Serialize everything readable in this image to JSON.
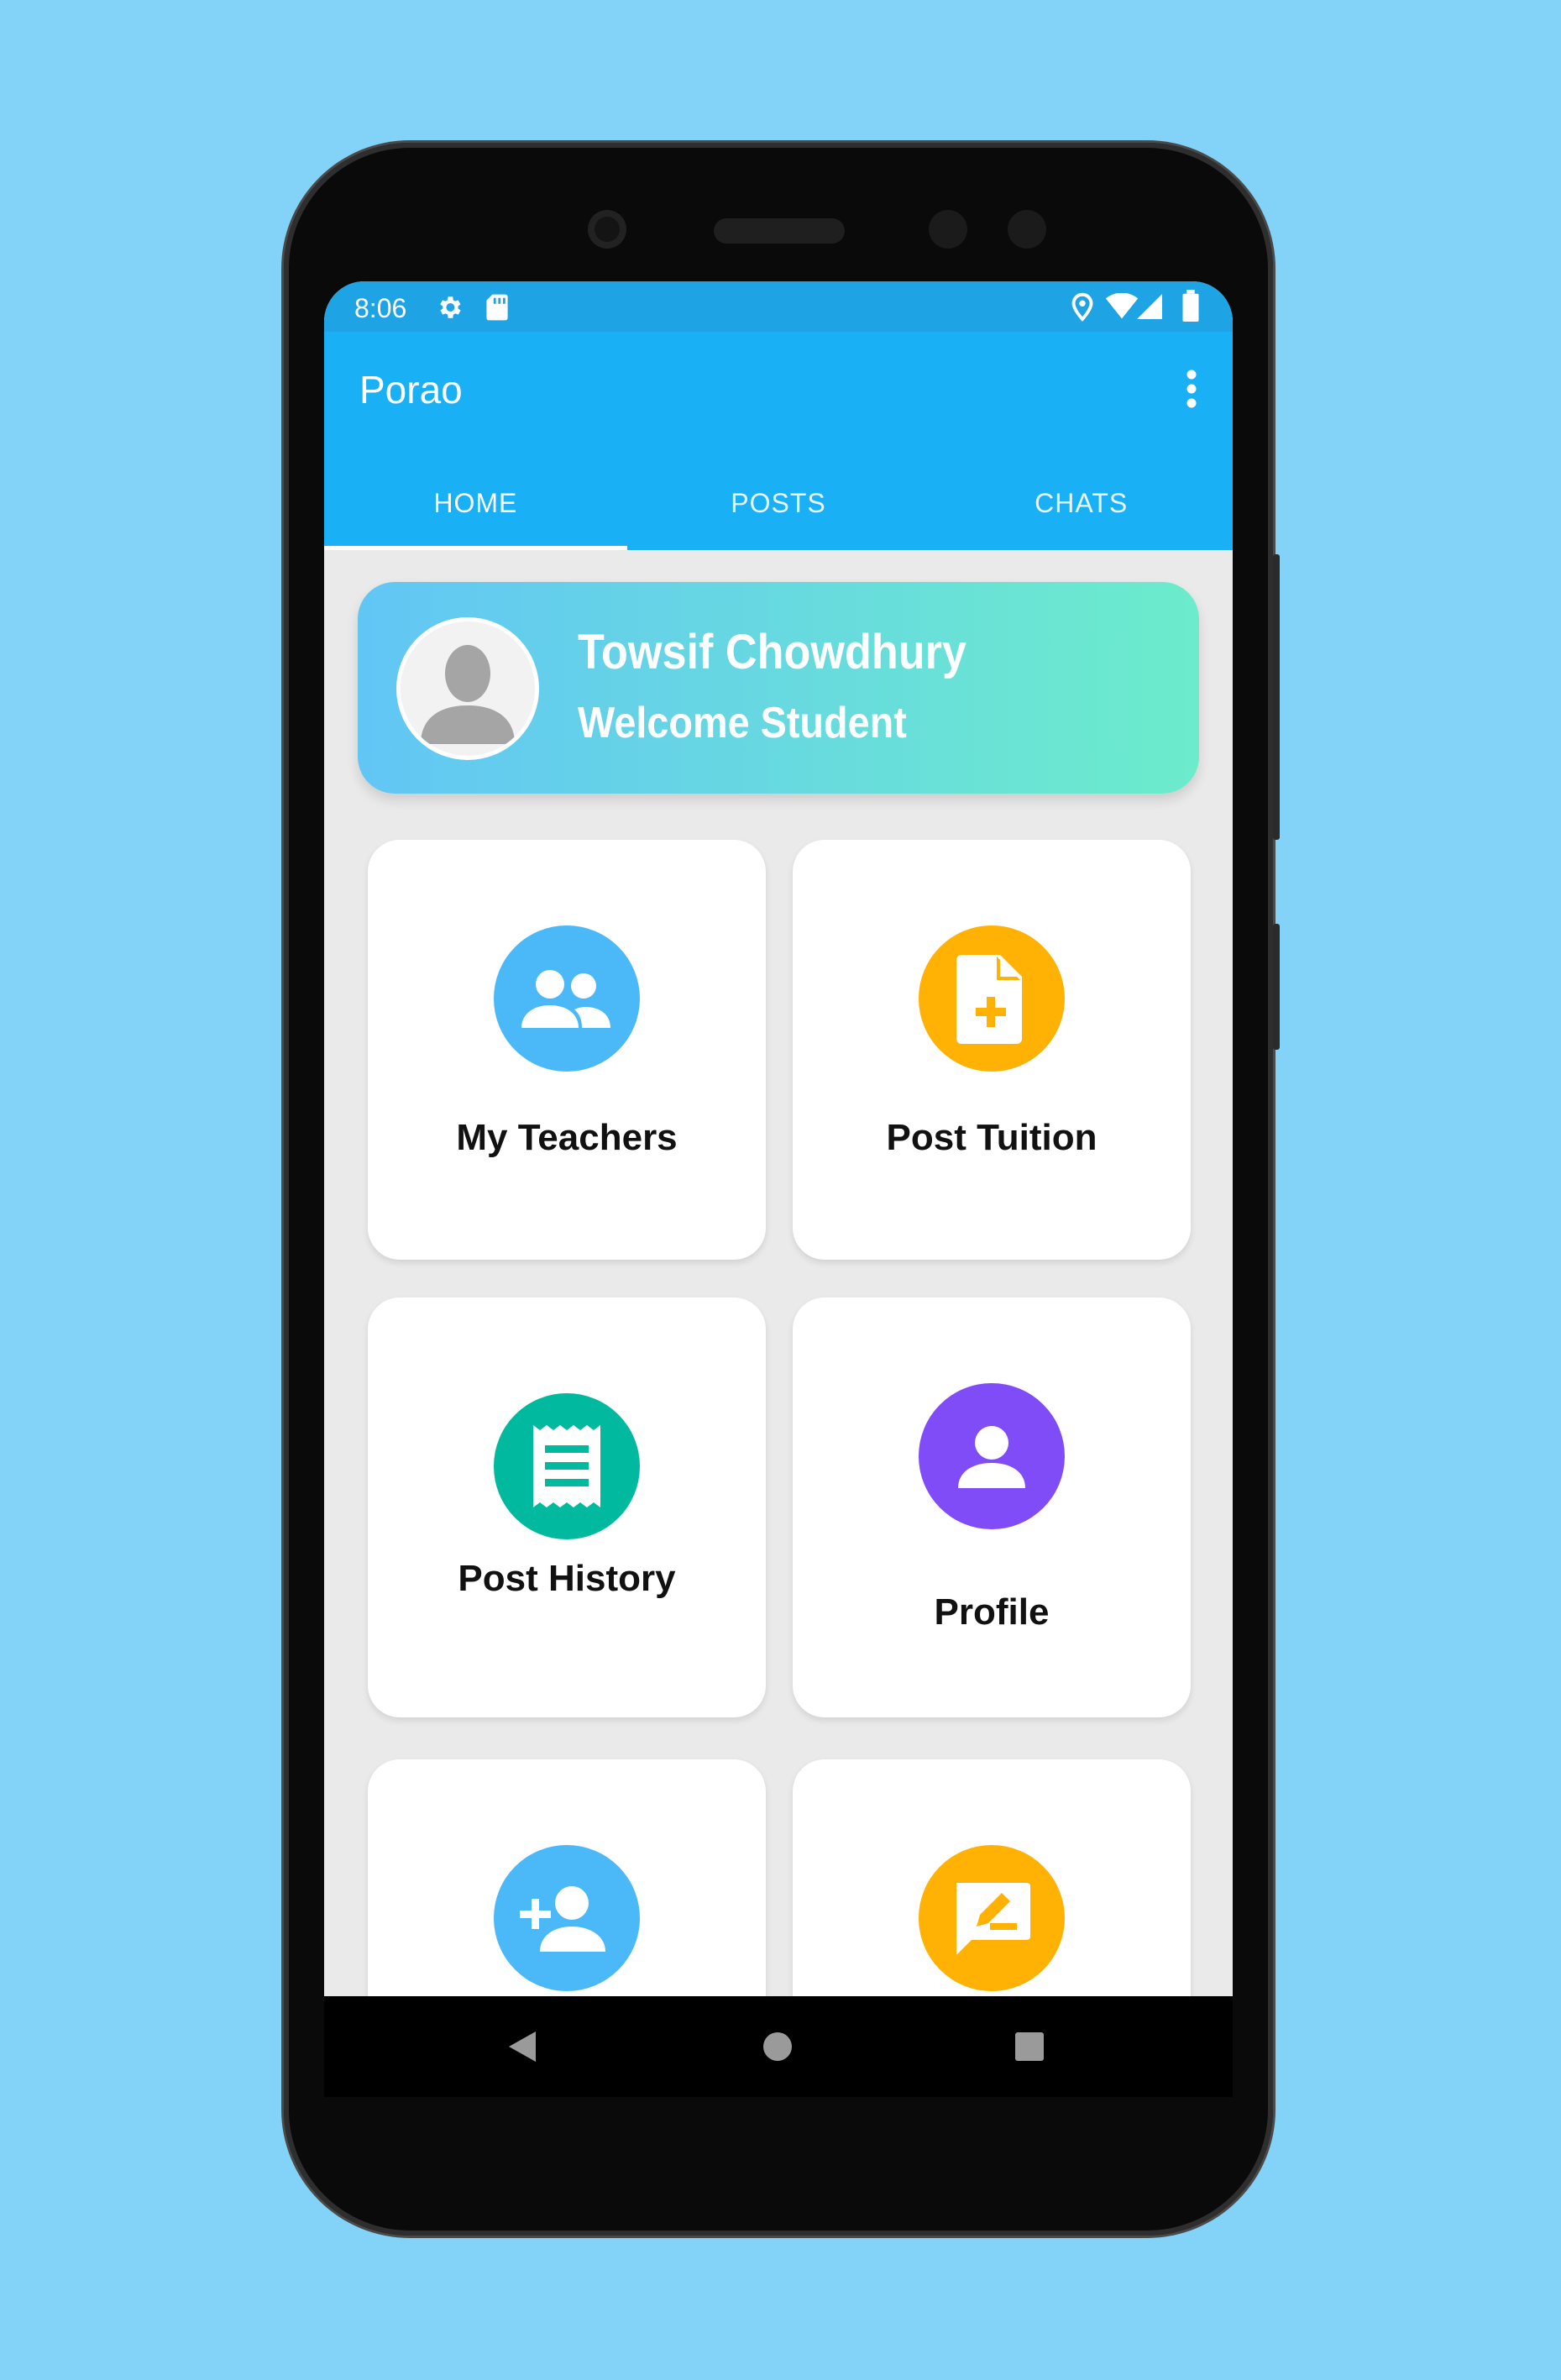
{
  "status_bar": {
    "time": "8:06"
  },
  "app_bar": {
    "title": "Porao"
  },
  "tabs": [
    {
      "label": "HOME",
      "active": true
    },
    {
      "label": "POSTS",
      "active": false
    },
    {
      "label": "CHATS",
      "active": false
    }
  ],
  "banner": {
    "name": "Towsif Chowdhury",
    "subtitle": "Welcome Student"
  },
  "cards": [
    {
      "label": "My Teachers",
      "icon": "people-icon",
      "color": "#4bb9f8"
    },
    {
      "label": "Post Tuition",
      "icon": "document-add-icon",
      "color": "#ffb204"
    },
    {
      "label": "Post History",
      "icon": "receipt-icon",
      "color": "#00b99e"
    },
    {
      "label": "Profile",
      "icon": "person-icon",
      "color": "#7f4cf8"
    },
    {
      "label": "",
      "icon": "add-person-icon",
      "color": "#4bb9f8"
    },
    {
      "label": "",
      "icon": "feedback-icon",
      "color": "#ffb204"
    }
  ],
  "colors": {
    "background": "#83d3f9",
    "status_bar": "#1ea4e4",
    "app_bar": "#1ab0f5"
  }
}
